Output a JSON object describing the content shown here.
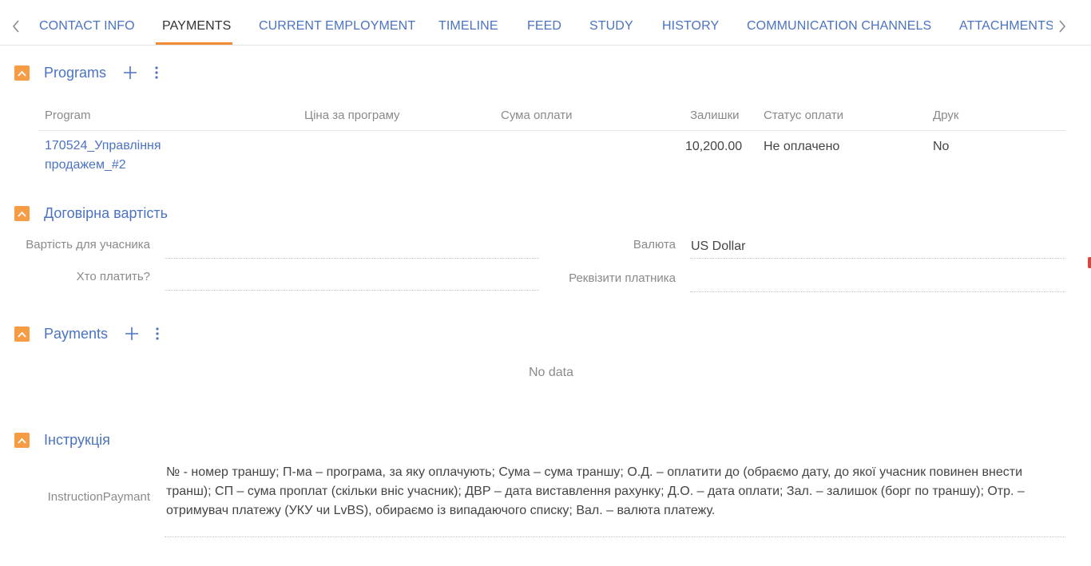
{
  "tabs": [
    {
      "label": "CONTACT INFO"
    },
    {
      "label": "PAYMENTS"
    },
    {
      "label": "CURRENT EMPLOYMENT"
    },
    {
      "label": "TIMELINE"
    },
    {
      "label": "FEED"
    },
    {
      "label": "STUDY"
    },
    {
      "label": "HISTORY"
    },
    {
      "label": "COMMUNICATION CHANNELS"
    },
    {
      "label": "ATTACHMENTS AND NOTES"
    }
  ],
  "active_tab": "PAYMENTS",
  "icons": {
    "tab_prev": "chevron-left-icon",
    "tab_next": "chevron-right-icon",
    "collapse": "chevron-up-icon",
    "add": "plus-icon",
    "menu": "vertical-dots-icon"
  },
  "colors": {
    "accent": "#f69c45",
    "link": "#4b73c2",
    "active_underline": "#f08b33"
  },
  "programs": {
    "title": "Programs",
    "columns": [
      "Program",
      "Ціна за програму",
      "Сума оплати",
      "Залишки",
      "Статус оплати",
      "Друк"
    ],
    "rows": [
      {
        "program": "170524_Управління продажем_#2",
        "price": "",
        "payment_sum": "",
        "balance": "10,200.00",
        "status": "Не оплачено",
        "print": "No"
      }
    ]
  },
  "contract": {
    "title": "Договірна вартість",
    "fields": {
      "cost_label": "Вартість для учасника",
      "cost_value": "",
      "currency_label": "Валюта",
      "currency_value": "US Dollar",
      "payer_label": "Хто платить?",
      "payer_value": "",
      "payer_details_label": "Реквізити платника",
      "payer_details_value": ""
    }
  },
  "payments": {
    "title": "Payments",
    "empty_text": "No data"
  },
  "instruction": {
    "title": "Інструкція",
    "field_label": "InstructionPaymant",
    "text": "№ - номер траншу; П-ма – програма, за яку оплачують; Сума – сума траншу; О.Д. – оплатити до (обраємо дату, до якої учасник повинен внести транш); СП – сума проплат (скільки вніс учасник); ДВР – дата виставлення рахунку; Д.О. – дата оплати; Зал. – залишок (борг по траншу); Отр. – отримувач платежу (УКУ чи LvBS), обираємо із випадаючого списку; Вал. – валюта платежу."
  }
}
